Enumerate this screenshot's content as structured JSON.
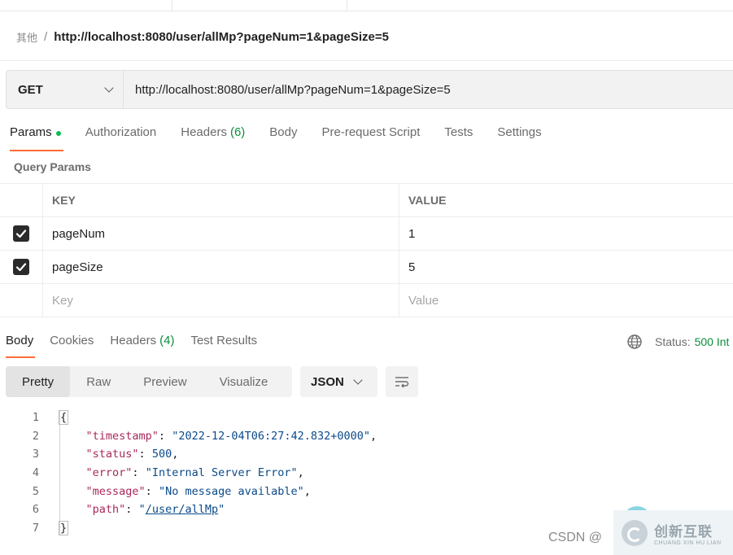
{
  "breadcrumb": {
    "parent": "其他",
    "separator": "/",
    "title": "http://localhost:8080/user/allMp?pageNum=1&pageSize=5"
  },
  "request": {
    "method": "GET",
    "url": "http://localhost:8080/user/allMp?pageNum=1&pageSize=5"
  },
  "request_tabs": [
    {
      "label": "Params",
      "active": true,
      "dot": true
    },
    {
      "label": "Authorization"
    },
    {
      "label": "Headers",
      "count": "(6)"
    },
    {
      "label": "Body"
    },
    {
      "label": "Pre-request Script"
    },
    {
      "label": "Tests"
    },
    {
      "label": "Settings"
    }
  ],
  "query_params": {
    "section_label": "Query Params",
    "columns": {
      "key": "KEY",
      "value": "VALUE"
    },
    "rows": [
      {
        "checked": true,
        "key": "pageNum",
        "value": "1"
      },
      {
        "checked": true,
        "key": "pageSize",
        "value": "5"
      }
    ],
    "placeholder": {
      "key": "Key",
      "value": "Value"
    }
  },
  "response_tabs": [
    {
      "label": "Body",
      "active": true
    },
    {
      "label": "Cookies"
    },
    {
      "label": "Headers",
      "count": "(4)"
    },
    {
      "label": "Test Results"
    }
  ],
  "status": {
    "label": "Status:",
    "value": "500 Int"
  },
  "view_modes": [
    "Pretty",
    "Raw",
    "Preview",
    "Visualize"
  ],
  "format": "JSON",
  "code": {
    "line_numbers": [
      "1",
      "2",
      "3",
      "4",
      "5",
      "6",
      "7"
    ],
    "open_brace": "{",
    "close_brace": "}",
    "fields": [
      {
        "key": "\"timestamp\"",
        "value": "\"2022-12-04T06:27:42.832+0000\"",
        "type": "string",
        "comma": ","
      },
      {
        "key": "\"status\"",
        "value": "500",
        "type": "number",
        "comma": ","
      },
      {
        "key": "\"error\"",
        "value": "\"Internal Server Error\"",
        "type": "string",
        "comma": ","
      },
      {
        "key": "\"message\"",
        "value": "\"No message available\"",
        "type": "string",
        "comma": ","
      },
      {
        "key": "\"path\"",
        "value": "/user/allMp",
        "type": "link",
        "comma": ""
      }
    ]
  },
  "watermark": {
    "text": "CSDN @",
    "logo_cn": "创新互联",
    "logo_en": "CHUANG XIN HU LIAN"
  },
  "colors": {
    "accent": "#ff6c37",
    "success": "#0a8f3c",
    "dot": "#0cbb52"
  }
}
